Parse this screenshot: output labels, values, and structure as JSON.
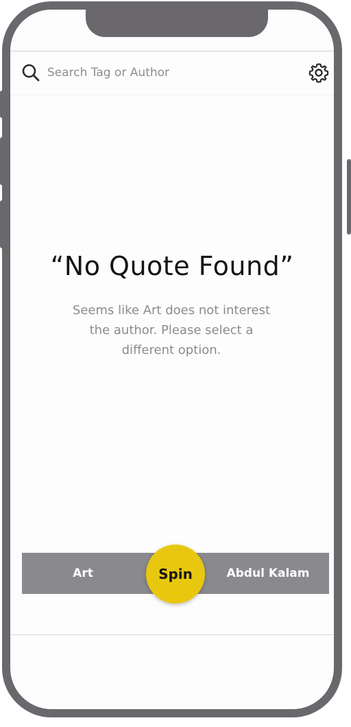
{
  "search": {
    "placeholder": "Search Tag or Author"
  },
  "quote": {
    "title": "“No Quote Found”",
    "message": "Seems like Art does not interest the author. Please select a different option."
  },
  "spinner": {
    "tag": "Art",
    "spin_label": "Spin",
    "author": "Abdul Kalam"
  },
  "icons": {
    "search": "search-icon",
    "settings": "gear-icon"
  },
  "colors": {
    "frame": "#6a686c",
    "spin_button": "#e8c80f",
    "spinner_bar": "#8a898d",
    "text_muted": "#8b8b8f",
    "title": "#141414"
  }
}
